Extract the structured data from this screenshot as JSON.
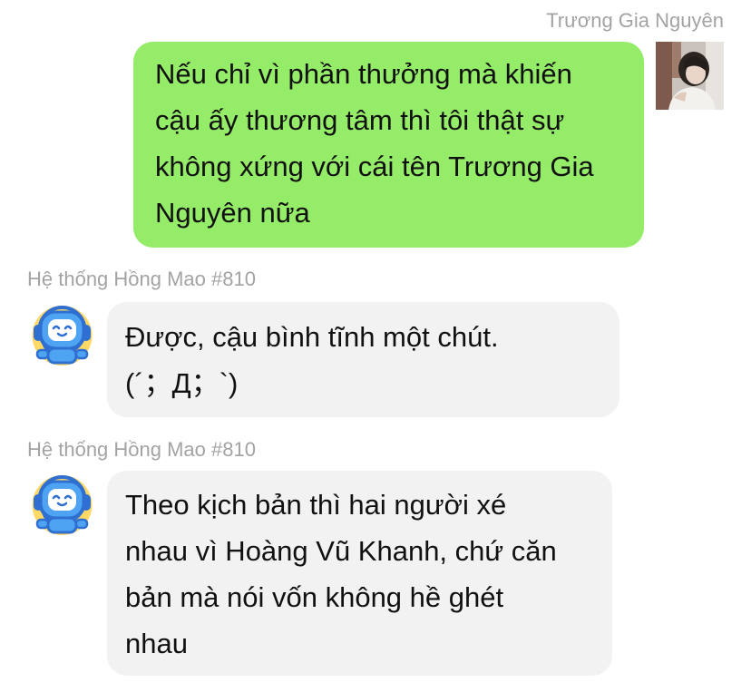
{
  "chat": {
    "messages": [
      {
        "sender": "Trương Gia Nguyên",
        "side": "right",
        "avatar_icon": "user-photo-avatar",
        "lines": [
          "Nếu chỉ vì phần thưởng mà khiến",
          "cậu ấy thương tâm thì tôi thật sự",
          "không xứng với cái tên Trương Gia",
          "Nguyên nữa"
        ]
      },
      {
        "sender": "Hệ thống Hồng Mao #810",
        "side": "left",
        "avatar_icon": "robot-headset-icon",
        "lines": [
          "Được, cậu bình tĩnh một chút.",
          "(´；Д；`)"
        ]
      },
      {
        "sender": "Hệ thống Hồng Mao #810",
        "side": "left",
        "avatar_icon": "robot-headset-icon",
        "lines": [
          "Theo kịch bản thì hai người xé",
          "nhau vì Hoàng Vũ Khanh, chứ căn",
          "bản mà nói vốn không hề ghét",
          "nhau"
        ]
      }
    ]
  },
  "colors": {
    "outgoing_bubble": "#95ec69",
    "incoming_bubble": "#f2f2f3",
    "sender_name": "#a3a3a3",
    "robot_body": "#4ea3f3",
    "robot_badge": "#ffd866"
  }
}
